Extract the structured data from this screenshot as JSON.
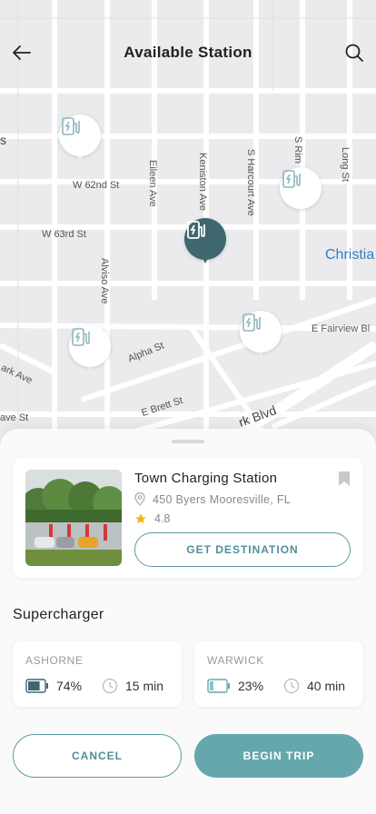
{
  "header": {
    "title": "Available Station"
  },
  "map": {
    "street_labels": {
      "w62nd": "W 62nd St",
      "w63rd": "W 63rd St",
      "eileen": "Eileen Ave",
      "keniston": "Keniston Ave",
      "harcourt": "S Harcourt Ave",
      "srim": "S Rim",
      "long": "Long St",
      "alviso": "Alviso Ave",
      "fairview": "E Fairview Bl",
      "alpha": "Alpha St",
      "brett": "E Brett St",
      "parkblvd": "rk Blvd",
      "christian": "Christia",
      "ark": "ark Ave",
      "ave_left": "ave St",
      "s_left": "s"
    },
    "pins": [
      {
        "name": "pin-1",
        "active": false
      },
      {
        "name": "pin-2",
        "active": false
      },
      {
        "name": "pin-3",
        "active": true
      },
      {
        "name": "pin-4",
        "active": false
      },
      {
        "name": "pin-5",
        "active": false
      }
    ]
  },
  "station": {
    "name": "Town Charging Station",
    "address": "450 Byers Mooresville, FL",
    "rating": "4.8",
    "destination_label": "GET DESTINATION"
  },
  "section_title": "Supercharger",
  "chargers": [
    {
      "name": "ASHORNE",
      "battery": "74%",
      "battery_level": 0.74,
      "time": "15 min"
    },
    {
      "name": "WARWICK",
      "battery": "23%",
      "battery_level": 0.23,
      "time": "40 min"
    }
  ],
  "actions": {
    "cancel_label": "CANCEL",
    "begin_label": "BEGIN TRIP"
  },
  "colors": {
    "accent": "#66a7ae",
    "accent_dark": "#3e6770",
    "star": "#f2b21b"
  }
}
